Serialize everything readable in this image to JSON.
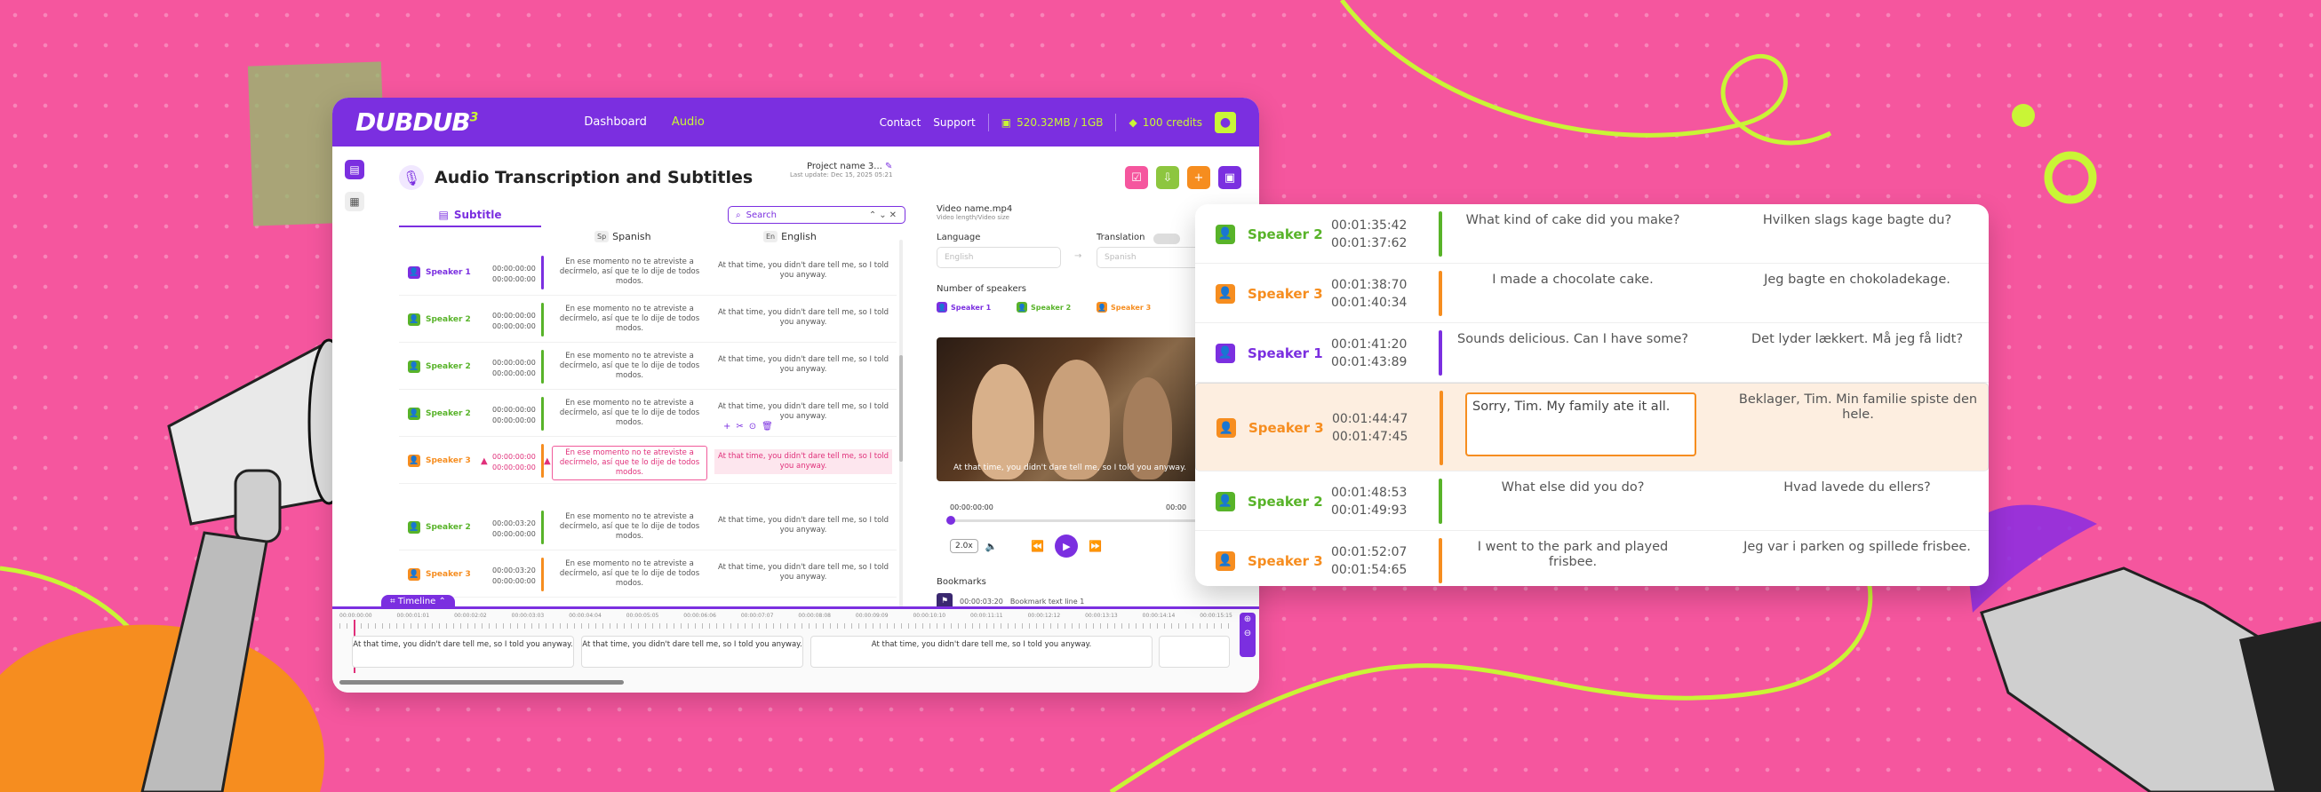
{
  "colors": {
    "brand": "#7b2fe0",
    "lime": "#c9f536",
    "pink": "#f5569e",
    "orange": "#f68d1f",
    "green": "#58b329",
    "purple": "#7b2fe0"
  },
  "app": {
    "logo": "DUBDUB",
    "logo_sup": "3",
    "nav": [
      "Dashboard",
      "Audio"
    ],
    "top_links": [
      "Contact",
      "Support"
    ],
    "storage": "520.32MB / 1GB",
    "credits": "100 credits",
    "title": "Audio Transcription and Subtitles",
    "project_name": "Project name 3...",
    "last_update": "Last update: Dec 15, 2025 05:21",
    "tab_subtitle": "Subtitle",
    "search_placeholder": "Search",
    "lang_src": "Spanish",
    "lang_src_code": "Sp",
    "lang_tgt": "English",
    "lang_tgt_code": "En",
    "rows": [
      {
        "speaker": "Speaker 1",
        "color": "#7b2fe0",
        "start": "00:00:00:00",
        "end": "00:00:00:00",
        "es": "En ese momento no te atreviste a decírmelo, así que te lo dije de todos modos.",
        "en": "At that time, you didn't dare tell me, so I told you anyway.",
        "error": false
      },
      {
        "speaker": "Speaker 2",
        "color": "#58b329",
        "start": "00:00:00:00",
        "end": "00:00:00:00",
        "es": "En ese momento no te atreviste a decírmelo, así que te lo dije de todos modos.",
        "en": "At that time, you didn't dare tell me, so I told you anyway.",
        "error": false
      },
      {
        "speaker": "Speaker 2",
        "color": "#58b329",
        "start": "00:00:00:00",
        "end": "00:00:00:00",
        "es": "En ese momento no te atreviste a decírmelo, así que te lo dije de todos modos.",
        "en": "At that time, you didn't dare tell me, so I told you anyway.",
        "error": false
      },
      {
        "speaker": "Speaker 2",
        "color": "#58b329",
        "start": "00:00:00:00",
        "end": "00:00:00:00",
        "es": "En ese momento no te atreviste a decírmelo, así que te lo dije de todos modos.",
        "en": "At that time, you didn't dare tell me, so I told you anyway.",
        "error": false
      },
      {
        "speaker": "Speaker 3",
        "color": "#f68d1f",
        "start": "00:00:00:00",
        "end": "00:00:00:00",
        "es": "En ese momento no te atreviste a decírmelo, así que te lo dije de todos modos.",
        "en": "At that time, you didn't dare tell me, so I told you anyway.",
        "error": true
      },
      {
        "speaker": "Speaker 2",
        "color": "#58b329",
        "start": "00:00:03:20",
        "end": "00:00:00:00",
        "es": "En ese momento no te atreviste a decírmelo, así que te lo dije de todos modos.",
        "en": "At that time, you didn't dare tell me, so I told you anyway.",
        "error": false
      },
      {
        "speaker": "Speaker 3",
        "color": "#f68d1f",
        "start": "00:00:03:20",
        "end": "00:00:00:00",
        "es": "En ese momento no te atreviste a decírmelo, así que te lo dije de todos modos.",
        "en": "At that time, you didn't dare tell me, so I told you anyway.",
        "error": false
      }
    ],
    "video_name": "Video name.mp4",
    "video_sub": "Video length/Video size",
    "language_label": "Language",
    "translation_label": "Translation",
    "lang_from": "English",
    "lang_to": "Spanish",
    "speakers_label": "Number of speakers",
    "speaker_chips": [
      {
        "name": "Speaker 1",
        "color": "#7b2fe0"
      },
      {
        "name": "Speaker 2",
        "color": "#58b329"
      },
      {
        "name": "Speaker 3",
        "color": "#f68d1f"
      }
    ],
    "video_caption": "At that time, you didn't dare tell me, so I told you anyway.",
    "player_time": "00:00:00:00",
    "player_time_end": "00:00",
    "speed": "2.0x",
    "bookmarks_label": "Bookmarks",
    "bookmark_time": "00:00:03:20",
    "bookmark_text": "Bookmark text line 1",
    "timeline_label": "Timeline",
    "ruler": [
      "00:00:00:00",
      "00:00:01:01",
      "00:00:02:02",
      "00:00:03:03",
      "00:00:04:04",
      "00:00:05:05",
      "00:00:06:06",
      "00:00:07:07",
      "00:00:08:08",
      "00:00:09:09",
      "00:00:10:10",
      "00:00:11:11",
      "00:00:12:12",
      "00:00:13:13",
      "00:00:14:14",
      "00:00:15:15"
    ],
    "clips": [
      "At that time, you didn't dare tell me, so I told you anyway.",
      "At that time, you didn't dare tell me, so I told you anyway.",
      "At that time, you didn't dare tell me, so I told you anyway."
    ]
  },
  "panel": {
    "rows": [
      {
        "speaker": "Speaker 2",
        "color": "#58b329",
        "start": "00:01:35:42",
        "end": "00:01:37:62",
        "text": "What kind of cake did you make?",
        "translation": "Hvilken slags kage bagte du?"
      },
      {
        "speaker": "Speaker 3",
        "color": "#f68d1f",
        "start": "00:01:38:70",
        "end": "00:01:40:34",
        "text": "I made a chocolate cake.",
        "translation": "Jeg bagte en chokoladekage."
      },
      {
        "speaker": "Speaker 1",
        "color": "#7b2fe0",
        "start": "00:01:41:20",
        "end": "00:01:43:89",
        "text": "Sounds delicious. Can I have some?",
        "translation": "Det lyder lækkert. Må jeg få lidt?"
      },
      {
        "speaker": "Speaker 3",
        "color": "#f68d1f",
        "start": "00:01:44:47",
        "end": "00:01:47:45",
        "text": "Sorry, Tim. My family ate it all.",
        "translation": "Beklager, Tim. Min familie spiste den hele.",
        "selected": true
      },
      {
        "speaker": "Speaker 2",
        "color": "#58b329",
        "start": "00:01:48:53",
        "end": "00:01:49:93",
        "text": "What else did you do?",
        "translation": "Hvad lavede du ellers?"
      },
      {
        "speaker": "Speaker 3",
        "color": "#f68d1f",
        "start": "00:01:52:07",
        "end": "00:01:54:65",
        "text": "I went to the park and played frisbee.",
        "translation": "Jeg var i parken og spillede frisbee."
      }
    ]
  }
}
